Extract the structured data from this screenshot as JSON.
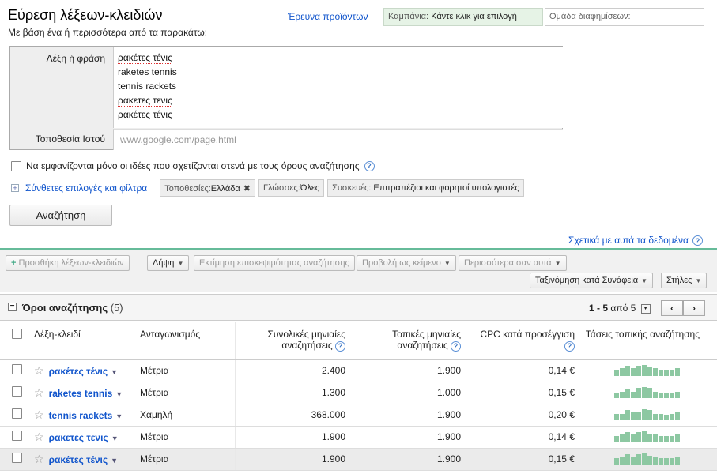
{
  "header": {
    "title": "Εύρεση λέξεων-κλειδιών",
    "subtitle": "Με βάση ένα ή περισσότερα από τα παρακάτω:",
    "research_link": "Έρευνα προϊόντων",
    "campaign_label": "Καμπάνια:",
    "campaign_value": "Κάντε κλικ για επιλογή",
    "adgroup_placeholder": "Ομάδα διαφημίσεων:"
  },
  "form": {
    "keyword_label": "Λέξη ή φράση",
    "keywords": [
      "ρακέτες τένις",
      "raketes tennis",
      "tennis rackets",
      "ρακετες τενις",
      "ρακέτες τένις"
    ],
    "site_label": "Τοποθεσία Ιστού",
    "site_placeholder": "www.google.com/page.html",
    "related_only_label": "Να εμφανίζονται μόνο οι ιδέες που σχετίζονται στενά με τους όρους αναζήτησης",
    "advanced_link": "Σύνθετες επιλογές και φίλτρα",
    "filters": [
      {
        "key": "Τοποθεσίες:",
        "value": "Ελλάδα",
        "removable": true
      },
      {
        "key": "Γλώσσες:",
        "value": "Όλες",
        "removable": false
      },
      {
        "key": "Συσκευές:",
        "value": "Επιτραπέζιοι και φορητοί υπολογιστές",
        "removable": false
      }
    ],
    "search_button": "Αναζήτηση",
    "about_link": "Σχετικά με αυτά τα δεδομένα"
  },
  "toolbar": {
    "add_keywords": "Προσθήκη λέξεων-κλειδιών",
    "download": "Λήψη",
    "estimate_traffic": "Εκτίμηση επισκεψιμότητας αναζήτησης",
    "view_as_text": "Προβολή ως κείμενο",
    "more_like_these": "Περισσότερα σαν αυτά",
    "sort": "Ταξινόμηση κατά Συνάφεια",
    "columns": "Στήλες"
  },
  "results": {
    "title": "Όροι αναζήτησης",
    "count": "(5)",
    "pager_range": "1 - 5",
    "pager_of": "από 5",
    "columns": {
      "keyword": "Λέξη-κλειδί",
      "competition": "Ανταγωνισμός",
      "global_searches": "Συνολικές μηνιαίες αναζητήσεις",
      "local_searches": "Τοπικές μηνιαίες αναζητήσεις",
      "cpc": "CPC κατά προσέγγιση",
      "trends": "Τάσεις τοπικής αναζήτησης"
    },
    "rows": [
      {
        "keyword": "ρακέτες τένις",
        "competition": "Μέτρια",
        "global": "2.400",
        "local": "1.900",
        "cpc": "0,14 €",
        "trend": [
          0.6,
          0.7,
          0.9,
          0.7,
          0.9,
          1.0,
          0.8,
          0.7,
          0.6,
          0.6,
          0.6,
          0.7
        ]
      },
      {
        "keyword": "raketes tennis",
        "competition": "Μέτρια",
        "global": "1.300",
        "local": "1.000",
        "cpc": "0,15 €",
        "trend": [
          0.5,
          0.6,
          0.8,
          0.6,
          0.9,
          1.0,
          0.9,
          0.6,
          0.5,
          0.5,
          0.5,
          0.6
        ]
      },
      {
        "keyword": "tennis rackets",
        "competition": "Χαμηλή",
        "global": "368.000",
        "local": "1.900",
        "cpc": "0,20 €",
        "trend": [
          0.6,
          0.6,
          0.9,
          0.7,
          0.8,
          1.0,
          0.9,
          0.6,
          0.6,
          0.5,
          0.6,
          0.7
        ]
      },
      {
        "keyword": "ρακετες τενις",
        "competition": "Μέτρια",
        "global": "1.900",
        "local": "1.900",
        "cpc": "0,14 €",
        "trend": [
          0.6,
          0.7,
          0.9,
          0.7,
          0.9,
          1.0,
          0.8,
          0.7,
          0.6,
          0.6,
          0.6,
          0.7
        ]
      },
      {
        "keyword": "ρακέτες τένις",
        "competition": "Μέτρια",
        "global": "1.900",
        "local": "1.900",
        "cpc": "0,15 €",
        "trend": [
          0.6,
          0.7,
          0.9,
          0.7,
          0.9,
          1.0,
          0.8,
          0.7,
          0.6,
          0.6,
          0.6,
          0.7
        ]
      }
    ]
  }
}
